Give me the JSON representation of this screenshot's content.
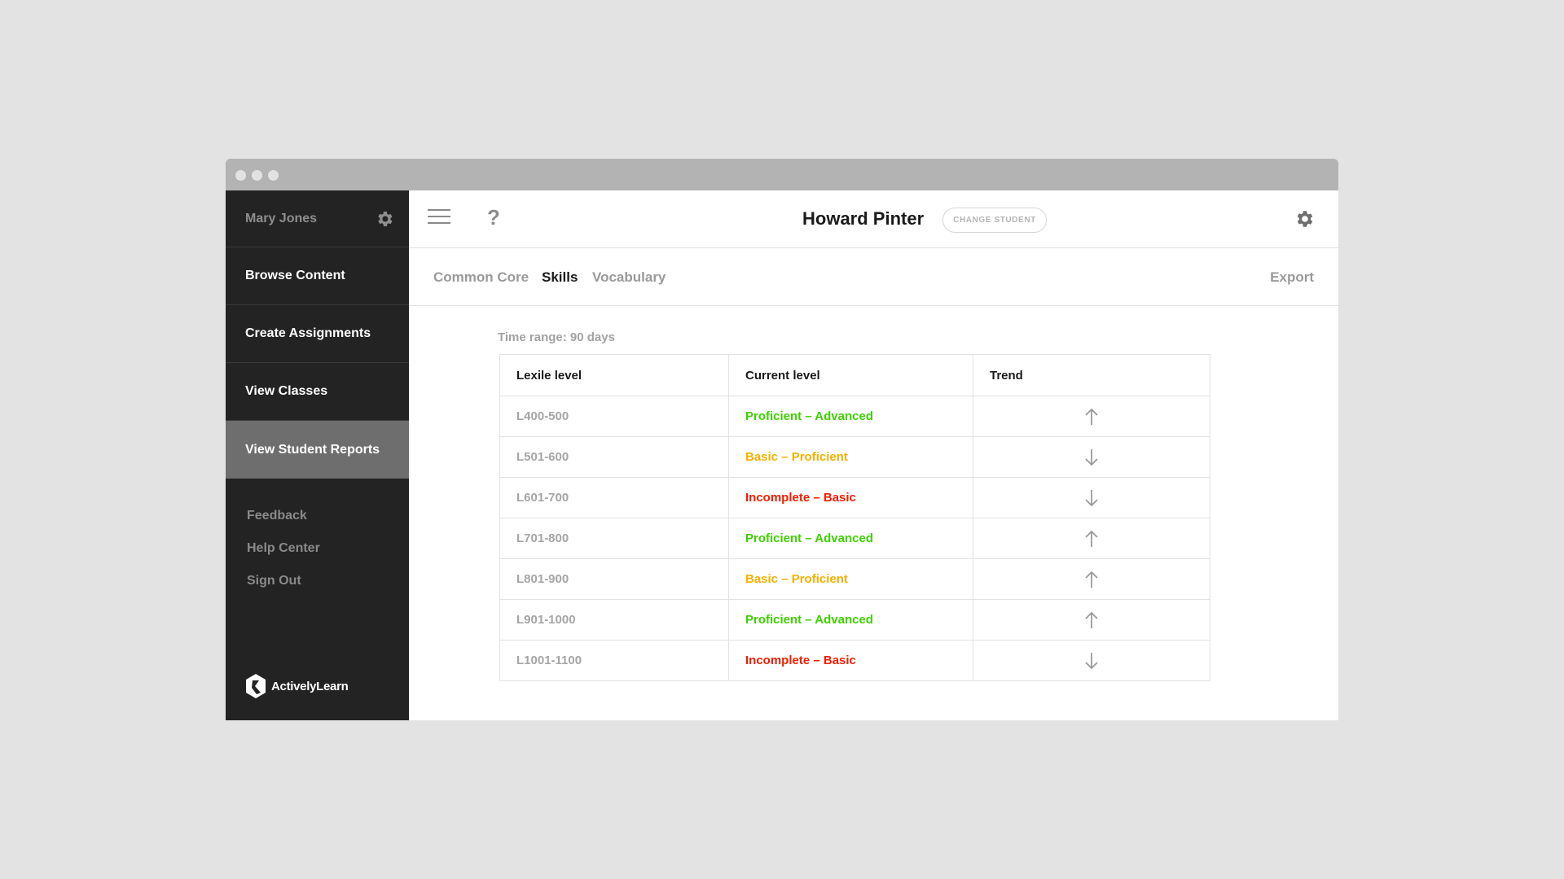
{
  "sidebar": {
    "user_name": "Mary Jones",
    "nav": [
      {
        "label": "Browse Content"
      },
      {
        "label": "Create Assignments"
      },
      {
        "label": "View Classes"
      },
      {
        "label": "View Student Reports"
      }
    ],
    "links": [
      {
        "label": "Feedback"
      },
      {
        "label": "Help Center"
      },
      {
        "label": "Sign Out"
      }
    ],
    "brand": "ActivelyLearn"
  },
  "header": {
    "help_glyph": "?",
    "student_name": "Howard Pinter",
    "change_student_label": "CHANGE STUDENT"
  },
  "tabs": [
    {
      "label": "Common Core"
    },
    {
      "label": "Skills"
    },
    {
      "label": "Vocabulary"
    }
  ],
  "export_label": "Export",
  "time_range": "Time range: 90 days",
  "table": {
    "headers": [
      "Lexile level",
      "Current level",
      "Trend"
    ],
    "rows": [
      {
        "level": "L400-500",
        "current": "Proficient – Advanced",
        "trend": "up"
      },
      {
        "level": "L501-600",
        "current": "Basic – Proficient",
        "trend": "down"
      },
      {
        "level": "L601-700",
        "current": "Incomplete – Basic",
        "trend": "down"
      },
      {
        "level": "L701-800",
        "current": "Proficient – Advanced",
        "trend": "up"
      },
      {
        "level": "L801-900",
        "current": "Basic – Proficient",
        "trend": "up"
      },
      {
        "level": "L901-1000",
        "current": "Proficient – Advanced",
        "trend": "up"
      },
      {
        "level": "L1001-1100",
        "current": "Incomplete – Basic",
        "trend": "down"
      }
    ]
  },
  "colors": {
    "proficient": "#3fd000",
    "basic": "#f5b000",
    "incomplete": "#f21d00",
    "sidebar_bg": "#232323",
    "sidebar_active": "#6e6e6e"
  },
  "icons": {
    "user_settings": "gear-icon",
    "menu": "hamburger-menu-icon",
    "help": "question-mark-icon",
    "settings": "gear-icon",
    "trend_up": "arrow-up-icon",
    "trend_down": "arrow-down-icon",
    "logo": "actively-learn-logo-icon"
  }
}
